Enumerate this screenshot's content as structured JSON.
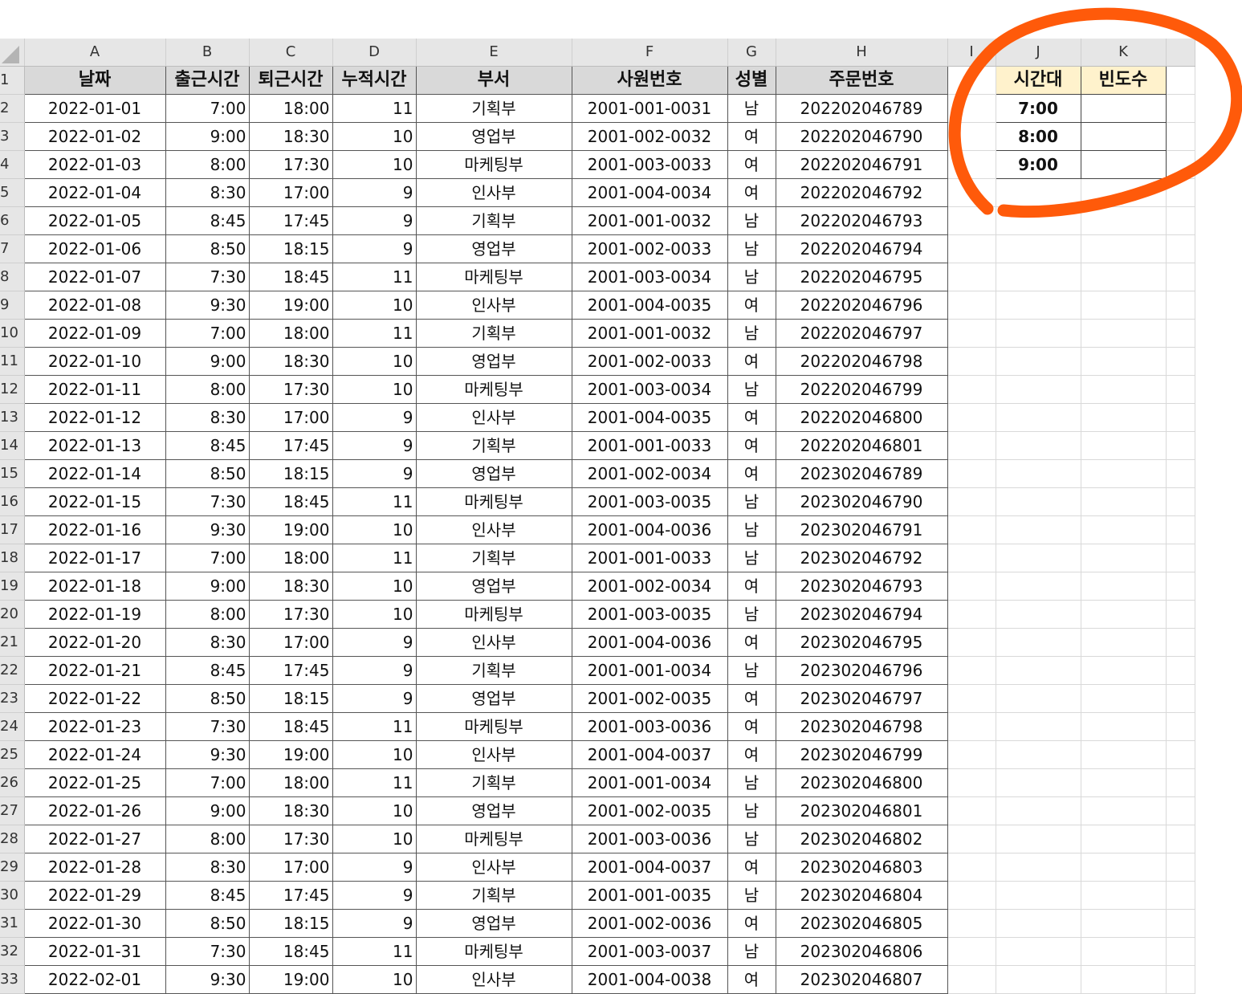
{
  "columns": [
    "A",
    "B",
    "C",
    "D",
    "E",
    "F",
    "G",
    "H",
    "I",
    "J",
    "K"
  ],
  "headers": [
    "날짜",
    "출근시간",
    "퇴근시간",
    "누적시간",
    "부서",
    "사원번호",
    "성별",
    "주문번호"
  ],
  "rows": [
    [
      "2022-01-01",
      "7:00",
      "18:00",
      "11",
      "기획부",
      "2001-001-0031",
      "남",
      "202202046789"
    ],
    [
      "2022-01-02",
      "9:00",
      "18:30",
      "10",
      "영업부",
      "2001-002-0032",
      "여",
      "202202046790"
    ],
    [
      "2022-01-03",
      "8:00",
      "17:30",
      "10",
      "마케팅부",
      "2001-003-0033",
      "여",
      "202202046791"
    ],
    [
      "2022-01-04",
      "8:30",
      "17:00",
      "9",
      "인사부",
      "2001-004-0034",
      "여",
      "202202046792"
    ],
    [
      "2022-01-05",
      "8:45",
      "17:45",
      "9",
      "기획부",
      "2001-001-0032",
      "남",
      "202202046793"
    ],
    [
      "2022-01-06",
      "8:50",
      "18:15",
      "9",
      "영업부",
      "2001-002-0033",
      "남",
      "202202046794"
    ],
    [
      "2022-01-07",
      "7:30",
      "18:45",
      "11",
      "마케팅부",
      "2001-003-0034",
      "남",
      "202202046795"
    ],
    [
      "2022-01-08",
      "9:30",
      "19:00",
      "10",
      "인사부",
      "2001-004-0035",
      "여",
      "202202046796"
    ],
    [
      "2022-01-09",
      "7:00",
      "18:00",
      "11",
      "기획부",
      "2001-001-0032",
      "남",
      "202202046797"
    ],
    [
      "2022-01-10",
      "9:00",
      "18:30",
      "10",
      "영업부",
      "2001-002-0033",
      "여",
      "202202046798"
    ],
    [
      "2022-01-11",
      "8:00",
      "17:30",
      "10",
      "마케팅부",
      "2001-003-0034",
      "남",
      "202202046799"
    ],
    [
      "2022-01-12",
      "8:30",
      "17:00",
      "9",
      "인사부",
      "2001-004-0035",
      "여",
      "202202046800"
    ],
    [
      "2022-01-13",
      "8:45",
      "17:45",
      "9",
      "기획부",
      "2001-001-0033",
      "여",
      "202202046801"
    ],
    [
      "2022-01-14",
      "8:50",
      "18:15",
      "9",
      "영업부",
      "2001-002-0034",
      "여",
      "202302046789"
    ],
    [
      "2022-01-15",
      "7:30",
      "18:45",
      "11",
      "마케팅부",
      "2001-003-0035",
      "남",
      "202302046790"
    ],
    [
      "2022-01-16",
      "9:30",
      "19:00",
      "10",
      "인사부",
      "2001-004-0036",
      "남",
      "202302046791"
    ],
    [
      "2022-01-17",
      "7:00",
      "18:00",
      "11",
      "기획부",
      "2001-001-0033",
      "남",
      "202302046792"
    ],
    [
      "2022-01-18",
      "9:00",
      "18:30",
      "10",
      "영업부",
      "2001-002-0034",
      "여",
      "202302046793"
    ],
    [
      "2022-01-19",
      "8:00",
      "17:30",
      "10",
      "마케팅부",
      "2001-003-0035",
      "남",
      "202302046794"
    ],
    [
      "2022-01-20",
      "8:30",
      "17:00",
      "9",
      "인사부",
      "2001-004-0036",
      "여",
      "202302046795"
    ],
    [
      "2022-01-21",
      "8:45",
      "17:45",
      "9",
      "기획부",
      "2001-001-0034",
      "남",
      "202302046796"
    ],
    [
      "2022-01-22",
      "8:50",
      "18:15",
      "9",
      "영업부",
      "2001-002-0035",
      "여",
      "202302046797"
    ],
    [
      "2022-01-23",
      "7:30",
      "18:45",
      "11",
      "마케팅부",
      "2001-003-0036",
      "여",
      "202302046798"
    ],
    [
      "2022-01-24",
      "9:30",
      "19:00",
      "10",
      "인사부",
      "2001-004-0037",
      "여",
      "202302046799"
    ],
    [
      "2022-01-25",
      "7:00",
      "18:00",
      "11",
      "기획부",
      "2001-001-0034",
      "남",
      "202302046800"
    ],
    [
      "2022-01-26",
      "9:00",
      "18:30",
      "10",
      "영업부",
      "2001-002-0035",
      "남",
      "202302046801"
    ],
    [
      "2022-01-27",
      "8:00",
      "17:30",
      "10",
      "마케팅부",
      "2001-003-0036",
      "남",
      "202302046802"
    ],
    [
      "2022-01-28",
      "8:30",
      "17:00",
      "9",
      "인사부",
      "2001-004-0037",
      "여",
      "202302046803"
    ],
    [
      "2022-01-29",
      "8:45",
      "17:45",
      "9",
      "기획부",
      "2001-001-0035",
      "남",
      "202302046804"
    ],
    [
      "2022-01-30",
      "8:50",
      "18:15",
      "9",
      "영업부",
      "2001-002-0036",
      "여",
      "202302046805"
    ],
    [
      "2022-01-31",
      "7:30",
      "18:45",
      "11",
      "마케팅부",
      "2001-003-0037",
      "남",
      "202302046806"
    ],
    [
      "2022-02-01",
      "9:30",
      "19:00",
      "10",
      "인사부",
      "2001-004-0038",
      "여",
      "202302046807"
    ]
  ],
  "side_table": {
    "header_time": "시간대",
    "header_freq": "빈도수",
    "times": [
      "7:00",
      "8:00",
      "9:00"
    ],
    "header_fill": "#fff2cc"
  },
  "annotation": {
    "shape": "circle",
    "color": "#ff5a0a",
    "target": "side_table"
  }
}
